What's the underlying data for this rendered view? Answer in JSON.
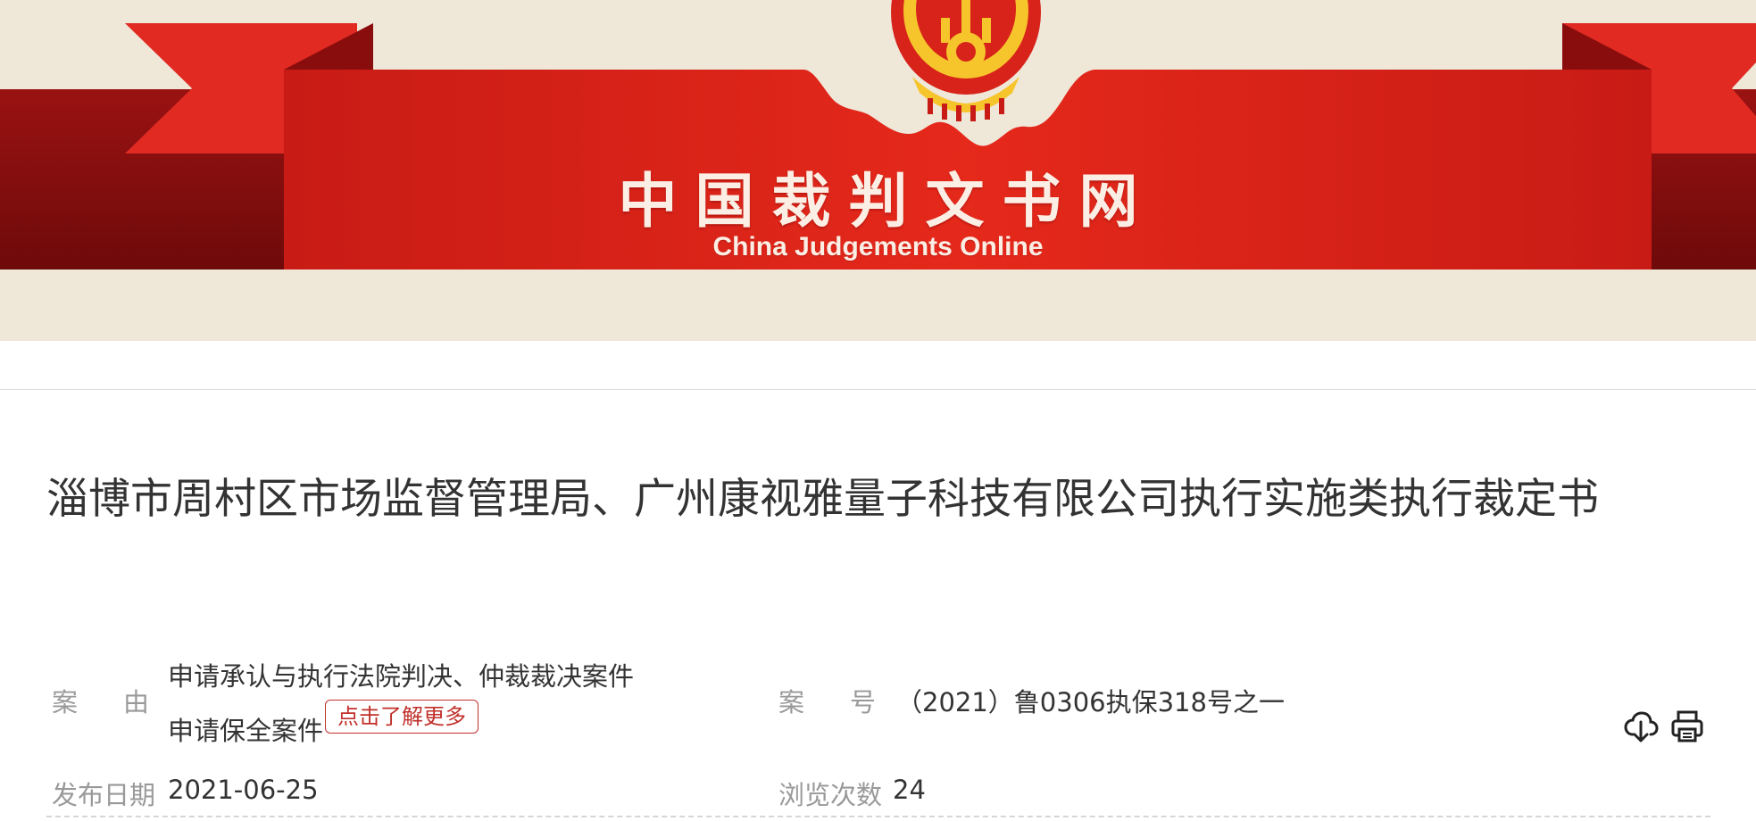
{
  "banner": {
    "site_name": "中国裁判文书网",
    "site_name_en": "China Judgements Online"
  },
  "document": {
    "title": "淄博市周村区市场监督管理局、广州康视雅量子科技有限公司执行实施类执行裁定书"
  },
  "meta": {
    "case_cause_label": "案由",
    "case_cause_lines": [
      "申请承认与执行法院判决、仲裁裁决案件",
      "申请保全案件"
    ],
    "learn_more": "点击了解更多",
    "case_no_label": "案号",
    "case_no": "（2021）鲁0306执保318号之一",
    "publish_date_label": "发布日期",
    "publish_date": "2021-06-25",
    "views_label": "浏览次数",
    "views": "24"
  },
  "icons": {
    "download": "cloud-download-icon",
    "print": "printer-icon"
  },
  "colors": {
    "banner_red": "#d8231a",
    "banner_dark_red": "#7c0d0d",
    "banner_bg": "#efe7d8",
    "emblem_gold": "#f6c52c",
    "accent": "#c0302b"
  }
}
